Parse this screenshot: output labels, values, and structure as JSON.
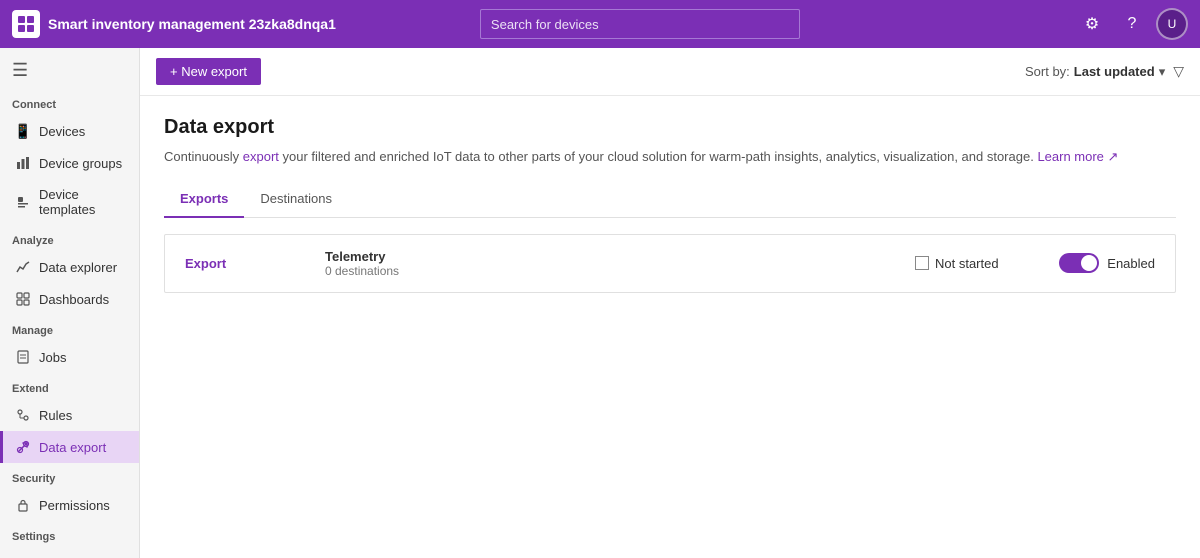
{
  "app": {
    "title": "Smart inventory management 23zka8dnqa1",
    "search_placeholder": "Search for devices"
  },
  "topnav": {
    "settings_icon": "⚙",
    "help_icon": "?",
    "avatar_initials": "U"
  },
  "sidebar": {
    "sections": [
      {
        "label": "Connect",
        "items": [
          {
            "id": "devices",
            "label": "Devices",
            "icon": "📱"
          },
          {
            "id": "device-groups",
            "label": "Device groups",
            "icon": "📊"
          },
          {
            "id": "device-templates",
            "label": "Device templates",
            "icon": "📋"
          }
        ]
      },
      {
        "label": "Analyze",
        "items": [
          {
            "id": "data-explorer",
            "label": "Data explorer",
            "icon": "📈"
          },
          {
            "id": "dashboards",
            "label": "Dashboards",
            "icon": "⊞"
          }
        ]
      },
      {
        "label": "Manage",
        "items": [
          {
            "id": "jobs",
            "label": "Jobs",
            "icon": "📄"
          }
        ]
      },
      {
        "label": "Extend",
        "items": [
          {
            "id": "rules",
            "label": "Rules",
            "icon": "⚡"
          },
          {
            "id": "data-export",
            "label": "Data export",
            "icon": "↗"
          }
        ]
      },
      {
        "label": "Security",
        "items": [
          {
            "id": "permissions",
            "label": "Permissions",
            "icon": "🔑"
          }
        ]
      },
      {
        "label": "Settings",
        "items": []
      }
    ]
  },
  "toolbar": {
    "new_export_label": "+ New export",
    "sort_prefix": "Sort by:",
    "sort_value": "Last updated",
    "sort_icon": "▾",
    "filter_icon": "▽"
  },
  "page": {
    "title": "Data export",
    "description_plain": "Continuously ",
    "description_export": "export",
    "description_middle": " your filtered and enriched IoT data to other parts of your cloud solution for warm-path insights, analytics, visualization, and storage.",
    "description_link": "Learn more",
    "description_link_icon": "↗"
  },
  "tabs": [
    {
      "id": "exports",
      "label": "Exports",
      "active": true
    },
    {
      "id": "destinations",
      "label": "Destinations",
      "active": false
    }
  ],
  "export_card": {
    "link_label": "Export",
    "telemetry_label": "Telemetry",
    "destinations_count": "0 destinations",
    "status_label": "Not started",
    "toggle_label": "Enabled",
    "toggle_enabled": true
  }
}
